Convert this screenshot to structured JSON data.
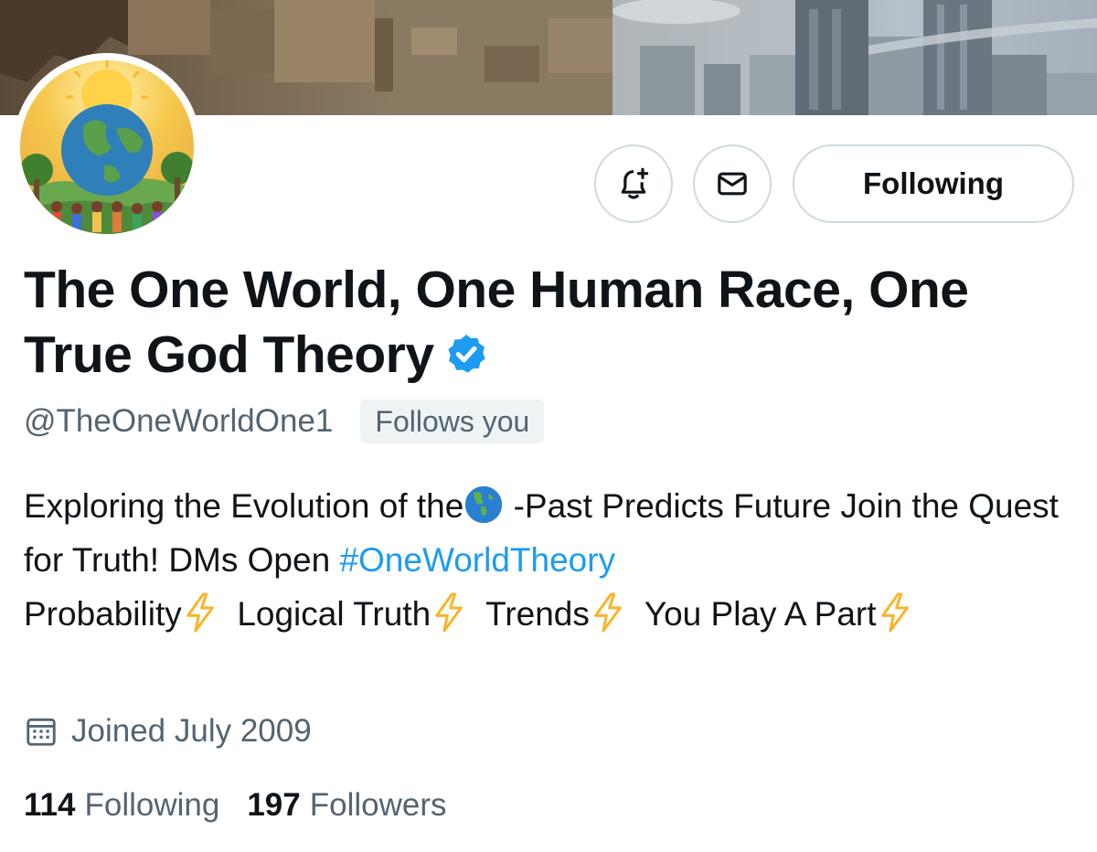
{
  "profile": {
    "follow_button_label": "Following",
    "display_name": "The One World, One Human Race, One True God Theory",
    "verified": true,
    "handle": "@TheOneWorldOne1",
    "follows_you_badge": "Follows you",
    "bio": {
      "part1": "Exploring the Evolution of the",
      "part2": " -Past Predicts Future Join the Quest for Truth! DMs Open ",
      "hashtag": "#OneWorldTheory",
      "item1": "Probability",
      "item2": "Logical Truth",
      "item3": "Trends",
      "item4": "You Play A Part"
    },
    "joined": "Joined July 2009",
    "following_count": "114",
    "following_label": "Following",
    "followers_count": "197",
    "followers_label": "Followers"
  },
  "icons": {
    "notify": "bell-plus-icon",
    "message": "envelope-icon",
    "verified": "verified-badge-icon",
    "joined": "calendar-icon",
    "globe_emoji": "globe-americas-emoji",
    "lightning_emoji": "lightning-emoji"
  },
  "colors": {
    "accent": "#1d9bf0",
    "secondary_text": "#536471",
    "primary_text": "#0f1419",
    "border": "#cfd9de"
  }
}
